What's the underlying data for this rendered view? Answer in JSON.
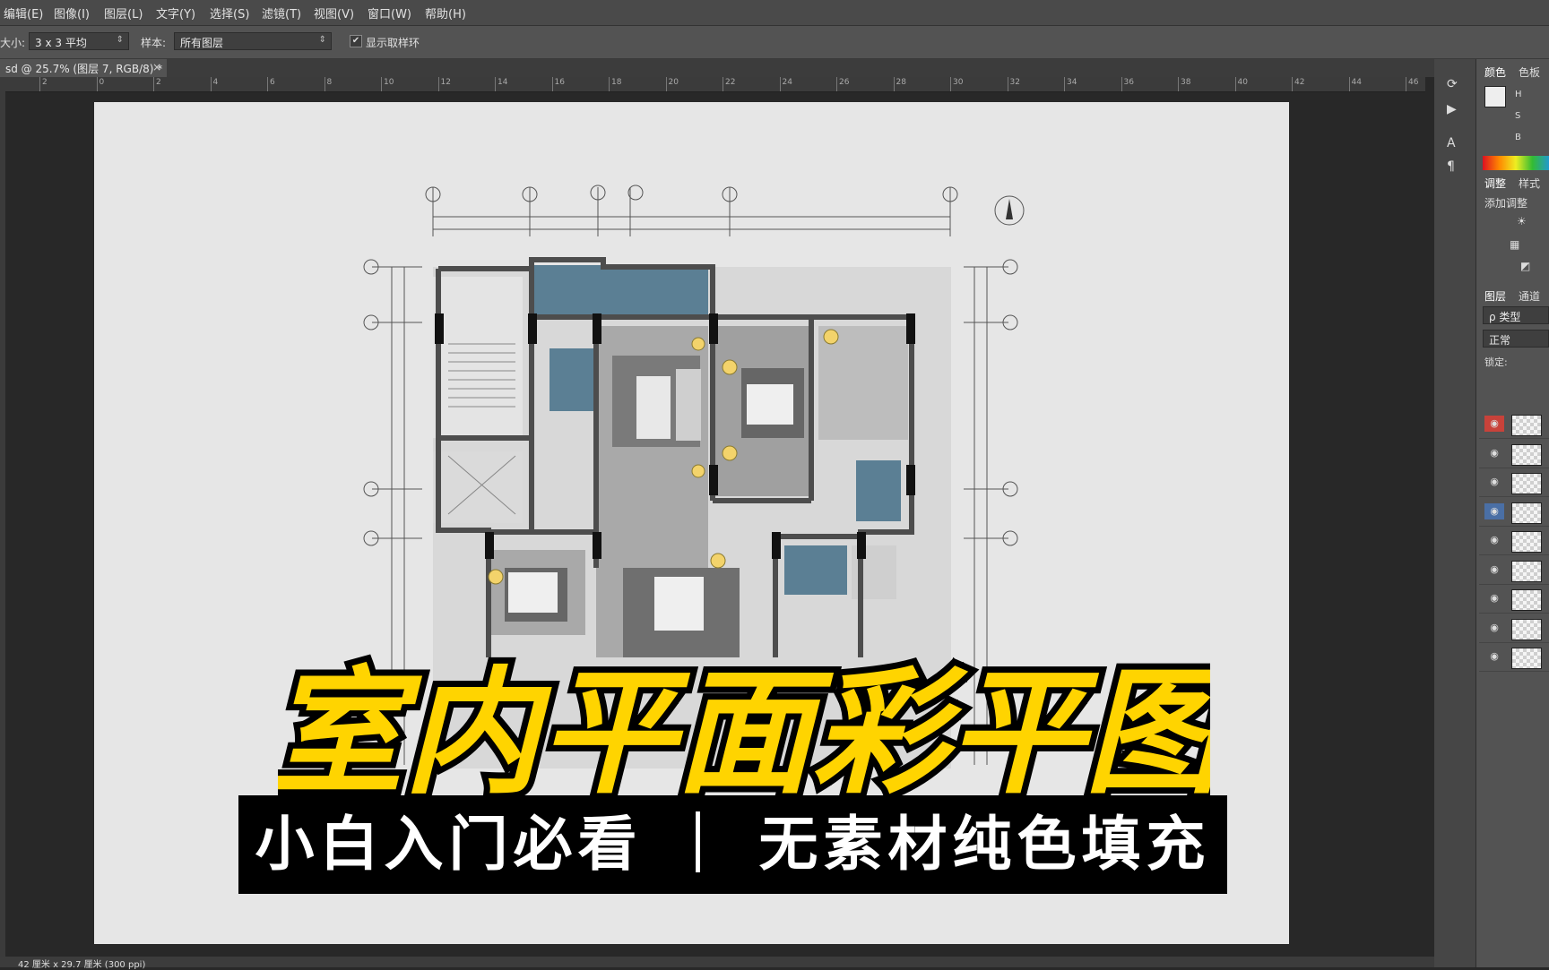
{
  "menubar": {
    "items": [
      "编辑(E)",
      "图像(I)",
      "图层(L)",
      "文字(Y)",
      "选择(S)",
      "滤镜(T)",
      "视图(V)",
      "窗口(W)",
      "帮助(H)"
    ]
  },
  "options": {
    "size_label": "大小:",
    "size_value": "3 x 3 平均",
    "sample_label": "样本:",
    "sample_value": "所有图层",
    "show_ring_checked": "✔",
    "show_ring_label": "显示取样环"
  },
  "document": {
    "tab_title": "sd @ 25.7% (图层 7, RGB/8) *",
    "close_glyph": "×"
  },
  "ruler": {
    "labels": [
      "2",
      "0",
      "2",
      "4",
      "6",
      "8",
      "10",
      "12",
      "14",
      "16",
      "18",
      "20",
      "22",
      "24",
      "26",
      "28",
      "30",
      "32",
      "34",
      "36",
      "38",
      "40",
      "42",
      "44",
      "46"
    ]
  },
  "panels": {
    "color_tab": "颜色",
    "swatches_tab": "色板",
    "h_label": "H",
    "s_label": "S",
    "b_label": "B",
    "adjust_tab": "调整",
    "style_tab": "样式",
    "add_adjust": "添加调整",
    "layers_tab": "图层",
    "channels_tab": "通道",
    "filter_kind": "ρ 类型",
    "blend_mode": "正常",
    "lock_label": "锁定:"
  },
  "layers": [
    {
      "eye": "◉",
      "highlight": "#c8423a"
    },
    {
      "eye": "◉",
      "highlight": ""
    },
    {
      "eye": "◉",
      "highlight": ""
    },
    {
      "eye": "◉",
      "highlight": "#4a6fa5"
    },
    {
      "eye": "◉",
      "highlight": ""
    },
    {
      "eye": "◉",
      "highlight": ""
    },
    {
      "eye": "◉",
      "highlight": ""
    },
    {
      "eye": "◉",
      "highlight": ""
    },
    {
      "eye": "◉",
      "highlight": ""
    }
  ],
  "status": {
    "doc_size": "42 厘米 x 29.7 厘米 (300 ppi)"
  },
  "overlay": {
    "title": "室内平面彩平图",
    "subtitle": "小白入门必看 ｜ 无素材纯色填充"
  },
  "colors": {
    "title_fill": "#ffd400",
    "room_blue": "#5b7f94",
    "wall": "#4d4d4d"
  }
}
